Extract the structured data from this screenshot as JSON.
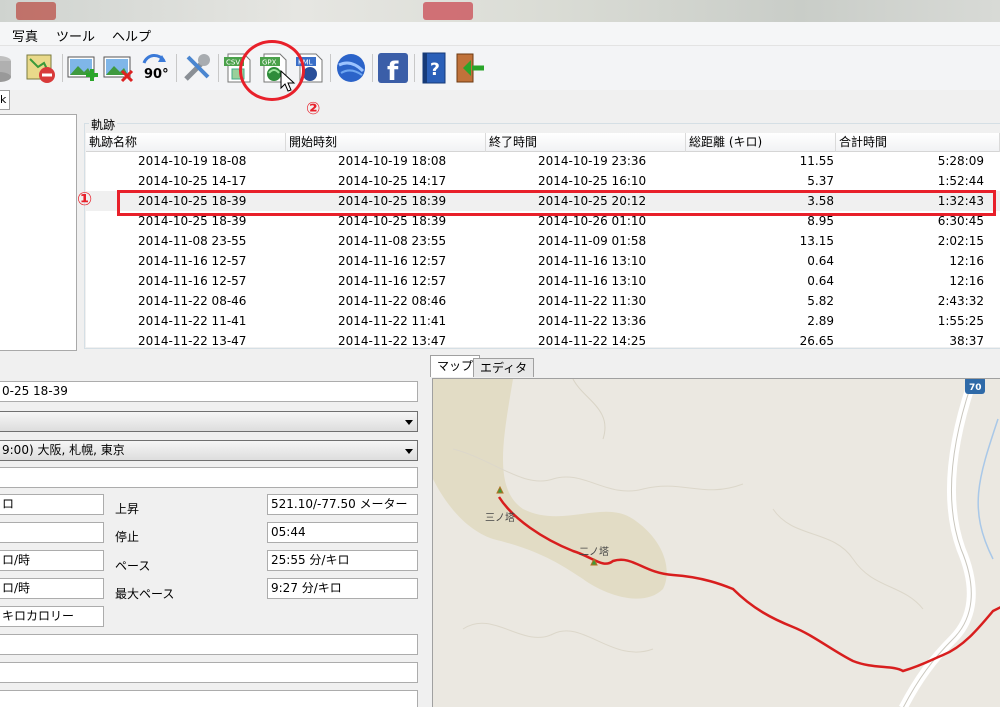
{
  "menu": [
    "写真",
    "ツール",
    "ヘルプ"
  ],
  "tab_fragment": "k",
  "tracks": {
    "title": "軌跡",
    "columns": [
      "軌跡名称",
      "開始時刻",
      "終了時間",
      "総距離 (キロ)",
      "合計時間"
    ],
    "rows": [
      {
        "name": "2014-10-19 18-08",
        "start": "2014-10-19 18:08",
        "end": "2014-10-19 23:36",
        "distance": "11.55",
        "total": "5:28:09"
      },
      {
        "name": "2014-10-25 14-17",
        "start": "2014-10-25 14:17",
        "end": "2014-10-25 16:10",
        "distance": "5.37",
        "total": "1:52:44"
      },
      {
        "name": "2014-10-25 18-39",
        "start": "2014-10-25 18:39",
        "end": "2014-10-25 20:12",
        "distance": "3.58",
        "total": "1:32:43"
      },
      {
        "name": "2014-10-25 18-39",
        "start": "2014-10-25 18:39",
        "end": "2014-10-26 01:10",
        "distance": "8.95",
        "total": "6:30:45"
      },
      {
        "name": "2014-11-08 23-55",
        "start": "2014-11-08 23:55",
        "end": "2014-11-09 01:58",
        "distance": "13.15",
        "total": "2:02:15"
      },
      {
        "name": "2014-11-16 12-57",
        "start": "2014-11-16 12:57",
        "end": "2014-11-16 13:10",
        "distance": "0.64",
        "total": "12:16"
      },
      {
        "name": "2014-11-16 12-57",
        "start": "2014-11-16 12:57",
        "end": "2014-11-16 13:10",
        "distance": "0.64",
        "total": "12:16"
      },
      {
        "name": "2014-11-22 08-46",
        "start": "2014-11-22 08:46",
        "end": "2014-11-22 11:30",
        "distance": "5.82",
        "total": "2:43:32"
      },
      {
        "name": "2014-11-22 11-41",
        "start": "2014-11-22 11:41",
        "end": "2014-11-22 13:36",
        "distance": "2.89",
        "total": "1:55:25"
      },
      {
        "name": "2014-11-22 13-47",
        "start": "2014-11-22 13:47",
        "end": "2014-11-22 14:25",
        "distance": "26.65",
        "total": "38:37"
      }
    ]
  },
  "annotations": {
    "one": "①",
    "two": "②"
  },
  "details": {
    "name_value": "0-25 18-39",
    "combo1_value": "",
    "timezone_value": "9:00) 大阪, 札幌, 東京",
    "left_values": [
      "ロ",
      "",
      "ロ/時",
      "ロ/時",
      "キロカロリー"
    ],
    "ascent_label": "上昇",
    "ascent_value": "521.10/-77.50 メーター",
    "stop_label": "停止",
    "stop_value": "05:44",
    "pace_label": "ペース",
    "pace_value": "25:55 分/キロ",
    "maxpace_label": "最大ペース",
    "maxpace_value": "9:27 分/キロ"
  },
  "map": {
    "tabs": [
      "マップ",
      "エディタ"
    ],
    "road_number": "70",
    "labels": [
      "三ノ塔",
      "二ノ塔"
    ]
  },
  "colors": {
    "annotation_red": "#e8202a",
    "track_red": "#d81e1e",
    "map_green": "#e2dcc5"
  }
}
